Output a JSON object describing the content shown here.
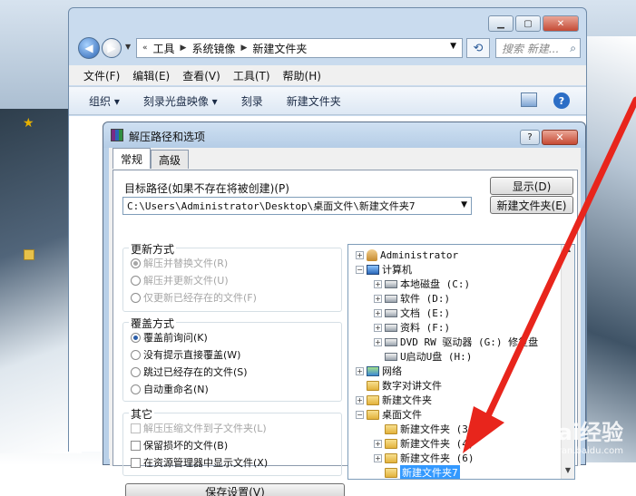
{
  "explorer": {
    "breadcrumb": [
      "工具",
      "系统镜像",
      "新建文件夹"
    ],
    "search_placeholder": "搜索 新建...",
    "menu": [
      "文件(F)",
      "编辑(E)",
      "查看(V)",
      "工具(T)",
      "帮助(H)"
    ],
    "toolbar": {
      "organize": "组织 ▾",
      "burn_image": "刻录光盘映像 ▾",
      "burn": "刻录",
      "new_folder": "新建文件夹"
    }
  },
  "dialog": {
    "title": "解压路径和选项",
    "tabs": [
      "常规",
      "高级"
    ],
    "target_label": "目标路径(如果不存在将被创建)(P)",
    "target_path": "C:\\Users\\Administrator\\Desktop\\桌面文件\\新建文件夹7",
    "show_button": "显示(D)",
    "new_folder_button": "新建文件夹(E)",
    "update_group": {
      "title": "更新方式",
      "options": [
        {
          "label": "解压并替换文件(R)",
          "selected": true
        },
        {
          "label": "解压并更新文件(U)",
          "selected": false
        },
        {
          "label": "仅更新已经存在的文件(F)",
          "selected": false
        }
      ]
    },
    "overwrite_group": {
      "title": "覆盖方式",
      "options": [
        {
          "label": "覆盖前询问(K)",
          "selected": true
        },
        {
          "label": "没有提示直接覆盖(W)",
          "selected": false
        },
        {
          "label": "跳过已经存在的文件(S)",
          "selected": false
        },
        {
          "label": "自动重命名(N)",
          "selected": false
        }
      ]
    },
    "other_group": {
      "title": "其它",
      "options": [
        {
          "label": "解压压缩文件到子文件夹(L)",
          "checked": false,
          "disabled": true
        },
        {
          "label": "保留损坏的文件(B)",
          "checked": false,
          "disabled": false
        },
        {
          "label": "在资源管理器中显示文件(X)",
          "checked": false,
          "disabled": false
        }
      ]
    },
    "save_button": "保存设置(V)",
    "tree": [
      {
        "label": "Administrator",
        "icon": "user-icon",
        "expander": "+"
      },
      {
        "label": "计算机",
        "icon": "computer-icon",
        "expander": "−"
      },
      {
        "label": "本地磁盘 (C:)",
        "icon": "drive-icon",
        "expander": "+"
      },
      {
        "label": "软件 (D:)",
        "icon": "drive-icon",
        "expander": "+"
      },
      {
        "label": "文档 (E:)",
        "icon": "drive-icon",
        "expander": "+"
      },
      {
        "label": "资料 (F:)",
        "icon": "drive-icon",
        "expander": "+"
      },
      {
        "label": "DVD RW 驱动器 (G:) 修复盘",
        "icon": "dvd-icon",
        "expander": "+"
      },
      {
        "label": "U启动U盘 (H:)",
        "icon": "usb-icon",
        "expander": ""
      },
      {
        "label": "网络",
        "icon": "network-icon",
        "expander": "+"
      },
      {
        "label": "数字对讲文件",
        "icon": "folder-icon",
        "expander": ""
      },
      {
        "label": "新建文件夹",
        "icon": "folder-icon",
        "expander": "+"
      },
      {
        "label": "桌面文件",
        "icon": "folder-icon",
        "expander": "−"
      },
      {
        "label": "新建文件夹 (3)",
        "icon": "folder-icon",
        "expander": ""
      },
      {
        "label": "新建文件夹 (4)",
        "icon": "folder-icon",
        "expander": "+"
      },
      {
        "label": "新建文件夹 (6)",
        "icon": "folder-icon",
        "expander": "+"
      },
      {
        "label": "新建文件夹7",
        "icon": "folder-icon",
        "expander": "",
        "selected": true
      }
    ]
  },
  "watermark": {
    "logo": "Bai经验",
    "url": "jingyan.baidu.com"
  },
  "colors": {
    "annotation_arrow": "#e8251c",
    "selection": "#3399ff"
  }
}
